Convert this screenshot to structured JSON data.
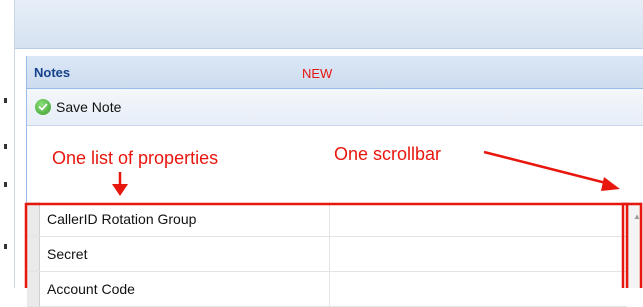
{
  "panel": {
    "title": "Notes",
    "new_tag": "NEW"
  },
  "toolbar": {
    "save_label": "Save Note",
    "save_icon": "check-circle-icon"
  },
  "annotations": {
    "list_label": "One list of properties",
    "scrollbar_label": "One scrollbar",
    "color": "#e8170e"
  },
  "properties": [
    {
      "name": "CallerID Rotation Group"
    },
    {
      "name": "Secret"
    },
    {
      "name": "Account Code"
    }
  ]
}
